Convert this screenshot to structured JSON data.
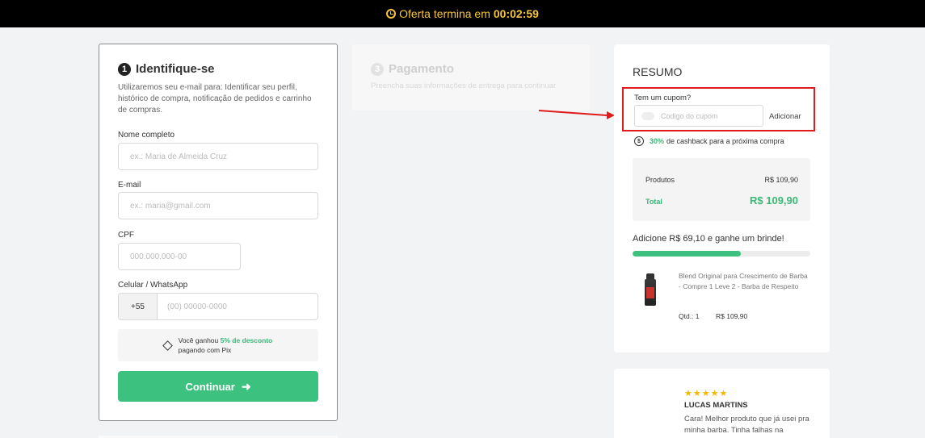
{
  "topbar": {
    "offer_label": "Oferta termina em",
    "timer": "00:02:59"
  },
  "identify": {
    "step": "1",
    "title": "Identifique-se",
    "description": "Utilizaremos seu e-mail para: Identificar seu perfil, histórico de compra, notificação de pedidos e carrinho de compras.",
    "name_label": "Nome completo",
    "name_placeholder": "ex.: Maria de Almeida Cruz",
    "email_label": "E-mail",
    "email_placeholder": "ex.: maria@gmail.com",
    "cpf_label": "CPF",
    "cpf_placeholder": "000.000.000-00",
    "phone_label": "Celular / WhatsApp",
    "phone_prefix": "+55",
    "phone_placeholder": "(00) 00000-0000",
    "pix_text_1": "Você ganhou",
    "pix_discount": "5% de desconto",
    "pix_text_2": "pagando com Pix",
    "continue_label": "Continuar"
  },
  "payment": {
    "step": "3",
    "title": "Pagamento",
    "description": "Preencha suas informações de entrega para continuar"
  },
  "summary": {
    "title": "RESUMO",
    "coupon_label": "Tem um cupom?",
    "coupon_placeholder": "Codigo do cupom",
    "coupon_add": "Adicionar",
    "cashback_percent": "30%",
    "cashback_text": "de cashback para a próxima compra",
    "products_label": "Produtos",
    "products_value": "R$ 109,90",
    "total_label": "Total",
    "total_value": "R$ 109,90",
    "gift_text": "Adicione R$ 69,10 e ganhe um brinde!",
    "gift_progress": 0.61,
    "product_name": "Blend Original para Crescimento de Barba - Compre 1 Leve 2 - Barba de Respeito",
    "product_qty": "Qtd.: 1",
    "product_price": "R$ 109,90"
  },
  "review": {
    "stars": "★★★★★",
    "name": "LUCAS MARTINS",
    "text": "Cara! Melhor produto que já usei pra minha barba. Tinha falhas na"
  },
  "colors": {
    "accent": "#3cc27e",
    "highlight": "#e01b1b",
    "timer": "#f5c542"
  }
}
